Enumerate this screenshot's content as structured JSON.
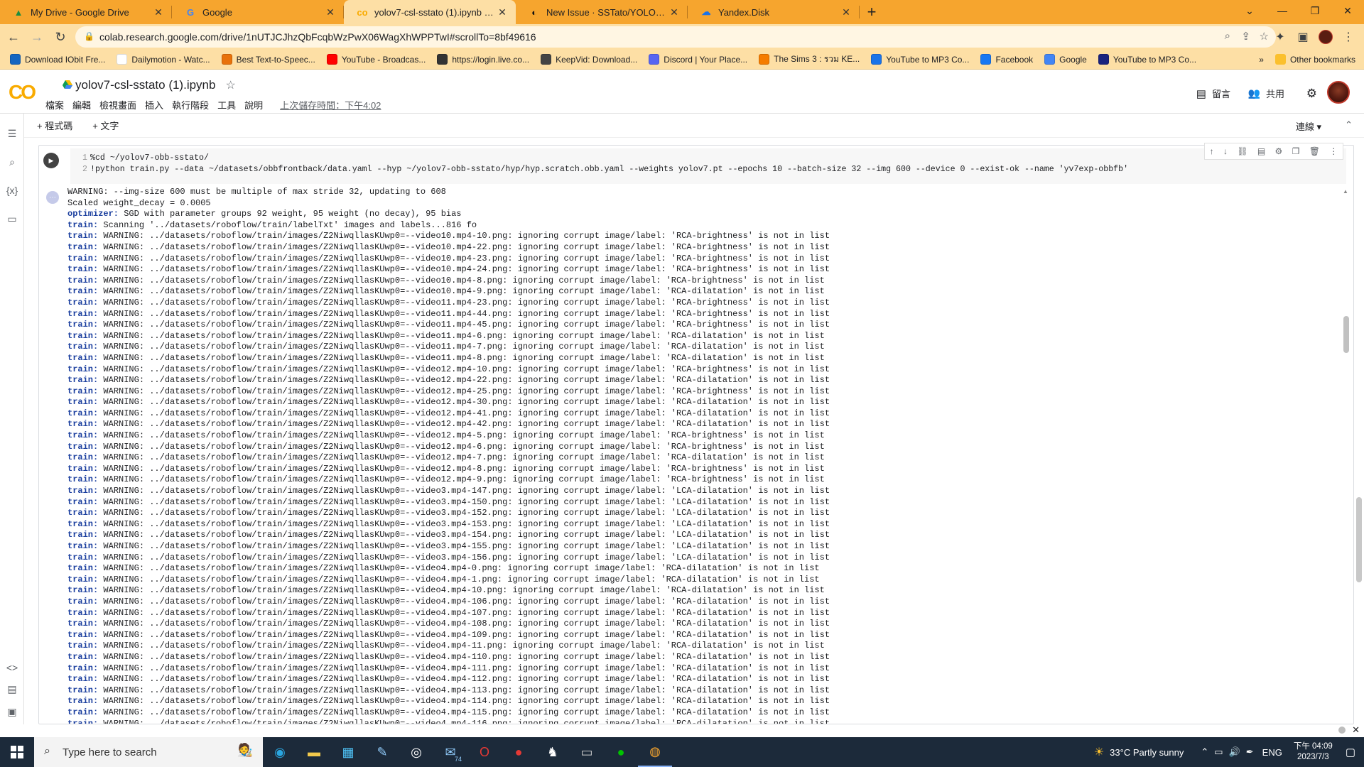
{
  "browser": {
    "tabs": [
      {
        "title": "My Drive - Google Drive",
        "icon": "drive-icon",
        "active": false
      },
      {
        "title": "Google",
        "icon": "google-icon",
        "active": false
      },
      {
        "title": "yolov7-csl-sstato (1).ipynb - Cola",
        "icon": "colab-icon",
        "active": true
      },
      {
        "title": "New Issue · SSTato/YOLOv7_obb",
        "icon": "github-icon",
        "active": false
      },
      {
        "title": "Yandex.Disk",
        "icon": "yandex-disk-icon",
        "active": false
      }
    ],
    "url": "colab.research.google.com/drive/1nUTJCJhzQbFcqbWzPwX06WagXhWPPTwI#scrollTo=8bf49616",
    "bookmarks": [
      {
        "label": "Download IObit Fre...",
        "icon": "iobit-icon",
        "color": "#1565c0"
      },
      {
        "label": "Dailymotion - Watc...",
        "icon": "dailymotion-icon",
        "color": "#ffffff"
      },
      {
        "label": "Best Text-to-Speec...",
        "icon": "tts-icon",
        "color": "#e8710a"
      },
      {
        "label": "YouTube - Broadcas...",
        "icon": "youtube-icon",
        "color": "#ff0000"
      },
      {
        "label": "https://login.live.co...",
        "icon": "live-icon",
        "color": "#333333"
      },
      {
        "label": "KeepVid: Download...",
        "icon": "keepvid-icon",
        "color": "#444444"
      },
      {
        "label": "Discord | Your Place...",
        "icon": "discord-icon",
        "color": "#5865f2"
      },
      {
        "label": "The Sims 3 : รวม KE...",
        "icon": "blogger-icon",
        "color": "#f57c00"
      },
      {
        "label": "YouTube to MP3 Co...",
        "icon": "ytmp3-icon",
        "color": "#1a73e8"
      },
      {
        "label": "Facebook",
        "icon": "facebook-icon",
        "color": "#1877f2"
      },
      {
        "label": "Google",
        "icon": "google-icon",
        "color": "#4285f4"
      },
      {
        "label": "YouTube to MP3 Co...",
        "icon": "kv-icon",
        "color": "#1a237e"
      }
    ],
    "other_bookmarks": "Other bookmarks",
    "overflow": "»"
  },
  "colab": {
    "notebook_title": "yolov7-csl-sstato (1).ipynb",
    "menu": [
      "檔案",
      "編輯",
      "檢視畫面",
      "插入",
      "執行階段",
      "工具",
      "說明"
    ],
    "last_saved": "上次儲存時間：下午4:02",
    "comment_label": "留言",
    "share_label": "共用",
    "add_code": "+ 程式碼",
    "add_text": "+ 文字",
    "connection": "連線",
    "code_lines": [
      {
        "n": "1",
        "text": "%cd  ~/yolov7-obb-sstato/"
      },
      {
        "n": "2",
        "text": "!python  train.py  --data  ~/datasets/obbfrontback/data.yaml  --hyp  ~/yolov7-obb-sstato/hyp/hyp.scratch.obb.yaml  --weights  yolov7.pt  --epochs  10  --batch-size  32  --img  600  --device  0  --exist-ok  --name  'yv7exp-obbfb'"
      }
    ],
    "output": {
      "header_lines": [
        "WARNING: --img-size 600 must be multiple of max stride 32, updating to 608",
        "Scaled weight_decay = 0.0005"
      ],
      "optimizer_prefix": "optimizer:",
      "optimizer_text": " SGD with parameter groups 92 weight, 95 weight (no decay), 95 bias",
      "train_prefix": "train:",
      "scan_text": " Scanning '../datasets/roboflow/train/labelTxt' images and labels...816 fo",
      "warning_prefix": " WARNING: ../datasets/roboflow/train/images/Z2NiwqllasKUwp0=--",
      "warnings": [
        [
          "video10.mp4-10.png",
          "RCA-brightness"
        ],
        [
          "video10.mp4-22.png",
          "RCA-brightness"
        ],
        [
          "video10.mp4-23.png",
          "RCA-brightness"
        ],
        [
          "video10.mp4-24.png",
          "RCA-brightness"
        ],
        [
          "video10.mp4-8.png",
          "RCA-brightness"
        ],
        [
          "video10.mp4-9.png",
          "RCA-dilatation"
        ],
        [
          "video11.mp4-23.png",
          "RCA-brightness"
        ],
        [
          "video11.mp4-44.png",
          "RCA-brightness"
        ],
        [
          "video11.mp4-45.png",
          "RCA-brightness"
        ],
        [
          "video11.mp4-6.png",
          "RCA-dilatation"
        ],
        [
          "video11.mp4-7.png",
          "RCA-dilatation"
        ],
        [
          "video11.mp4-8.png",
          "RCA-dilatation"
        ],
        [
          "video12.mp4-10.png",
          "RCA-brightness"
        ],
        [
          "video12.mp4-22.png",
          "RCA-dilatation"
        ],
        [
          "video12.mp4-25.png",
          "RCA-brightness"
        ],
        [
          "video12.mp4-30.png",
          "RCA-dilatation"
        ],
        [
          "video12.mp4-41.png",
          "RCA-dilatation"
        ],
        [
          "video12.mp4-42.png",
          "RCA-dilatation"
        ],
        [
          "video12.mp4-5.png",
          "RCA-brightness"
        ],
        [
          "video12.mp4-6.png",
          "RCA-brightness"
        ],
        [
          "video12.mp4-7.png",
          "RCA-dilatation"
        ],
        [
          "video12.mp4-8.png",
          "RCA-brightness"
        ],
        [
          "video12.mp4-9.png",
          "RCA-brightness"
        ],
        [
          "video3.mp4-147.png",
          "LCA-dilatation"
        ],
        [
          "video3.mp4-150.png",
          "LCA-dilatation"
        ],
        [
          "video3.mp4-152.png",
          "LCA-dilatation"
        ],
        [
          "video3.mp4-153.png",
          "LCA-dilatation"
        ],
        [
          "video3.mp4-154.png",
          "LCA-dilatation"
        ],
        [
          "video3.mp4-155.png",
          "LCA-dilatation"
        ],
        [
          "video3.mp4-156.png",
          "LCA-dilatation"
        ],
        [
          "video4.mp4-0.png",
          "RCA-dilatation"
        ],
        [
          "video4.mp4-1.png",
          "RCA-dilatation"
        ],
        [
          "video4.mp4-10.png",
          "RCA-dilatation"
        ],
        [
          "video4.mp4-106.png",
          "RCA-dilatation"
        ],
        [
          "video4.mp4-107.png",
          "RCA-dilatation"
        ],
        [
          "video4.mp4-108.png",
          "RCA-dilatation"
        ],
        [
          "video4.mp4-109.png",
          "RCA-dilatation"
        ],
        [
          "video4.mp4-11.png",
          "RCA-dilatation"
        ],
        [
          "video4.mp4-110.png",
          "RCA-dilatation"
        ],
        [
          "video4.mp4-111.png",
          "RCA-dilatation"
        ],
        [
          "video4.mp4-112.png",
          "RCA-dilatation"
        ],
        [
          "video4.mp4-113.png",
          "RCA-dilatation"
        ],
        [
          "video4.mp4-114.png",
          "RCA-dilatation"
        ],
        [
          "video4.mp4-115.png",
          "RCA-dilatation"
        ],
        [
          "video4.mp4-116.png",
          "RCA-dilatation"
        ]
      ],
      "ignore_text": ": ignoring corrupt image/label: ",
      "not_in_list": " is not in list"
    }
  },
  "taskbar": {
    "search_placeholder": "Type here to search",
    "mail_badge": "74",
    "weather": "33°C  Partly sunny",
    "lang": "ENG",
    "time": "下午 04:09",
    "date": "2023/7/3"
  },
  "colors": {
    "tabstrip": "#f6a52e",
    "toolbar": "#fddfa5",
    "colab_orange": "#f9ab00",
    "output_prefix": "#1a3e9e"
  }
}
